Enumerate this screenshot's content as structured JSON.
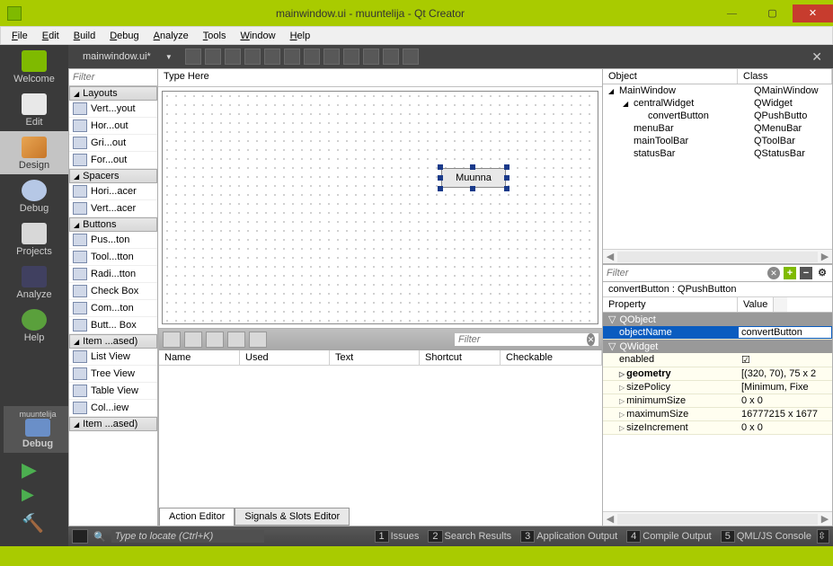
{
  "window": {
    "title": "mainwindow.ui - muuntelija - Qt Creator"
  },
  "menubar": [
    "File",
    "Edit",
    "Build",
    "Debug",
    "Analyze",
    "Tools",
    "Window",
    "Help"
  ],
  "modes": {
    "welcome": "Welcome",
    "edit": "Edit",
    "design": "Design",
    "debug": "Debug",
    "projects": "Projects",
    "analyze": "Analyze",
    "help": "Help"
  },
  "project_label": "muuntelija",
  "run_label": "Debug",
  "open_tab": "mainwindow.ui*",
  "widgetbox": {
    "filter_placeholder": "Filter",
    "categories": [
      {
        "name": "Layouts",
        "items": [
          "Vert...yout",
          "Hor...out",
          "Gri...out",
          "For...out"
        ]
      },
      {
        "name": "Spacers",
        "items": [
          "Hori...acer",
          "Vert...acer"
        ]
      },
      {
        "name": "Buttons",
        "items": [
          "Pus...ton",
          "Tool...tton",
          "Radi...tton",
          "Check Box",
          "Com...ton",
          "Butt... Box"
        ]
      },
      {
        "name": "Item ...ased)",
        "items": [
          "List View",
          "Tree View",
          "Table View",
          "Col...iew"
        ]
      },
      {
        "name": "Item ...ased)",
        "items": []
      }
    ]
  },
  "form": {
    "type_here": "Type Here",
    "button_text": "Muunna"
  },
  "objtree": {
    "col_object": "Object",
    "col_class": "Class",
    "rows": [
      {
        "name": "MainWindow",
        "class": "QMainWindow",
        "indent": 0,
        "expand": true
      },
      {
        "name": "centralWidget",
        "class": "QWidget",
        "indent": 1,
        "expand": true
      },
      {
        "name": "convertButton",
        "class": "QPushButto",
        "indent": 2
      },
      {
        "name": "menuBar",
        "class": "QMenuBar",
        "indent": 1
      },
      {
        "name": "mainToolBar",
        "class": "QToolBar",
        "indent": 1
      },
      {
        "name": "statusBar",
        "class": "QStatusBar",
        "indent": 1
      }
    ]
  },
  "actions": {
    "filter_placeholder": "Filter",
    "cols": [
      "Name",
      "Used",
      "Text",
      "Shortcut",
      "Checkable"
    ],
    "tabs": {
      "action": "Action Editor",
      "signals": "Signals & Slots Editor"
    }
  },
  "props": {
    "filter_placeholder": "Filter",
    "title": "convertButton : QPushButton",
    "col_prop": "Property",
    "col_val": "Value",
    "rows": [
      {
        "cat": "QObject"
      },
      {
        "name": "objectName",
        "value": "convertButton",
        "sel": true
      },
      {
        "cat": "QWidget"
      },
      {
        "name": "enabled",
        "value": "☑"
      },
      {
        "name": "geometry",
        "value": "[(320, 70), 75 x 2",
        "bold": true,
        "tri": true
      },
      {
        "name": "sizePolicy",
        "value": "[Minimum, Fixe",
        "tri": true
      },
      {
        "name": "minimumSize",
        "value": "0 x 0",
        "tri": true
      },
      {
        "name": "maximumSize",
        "value": "16777215 x 1677",
        "tri": true
      },
      {
        "name": "sizeIncrement",
        "value": "0 x 0",
        "tri": true
      }
    ]
  },
  "locator": {
    "placeholder": "Type to locate (Ctrl+K)",
    "items": [
      "Issues",
      "Search Results",
      "Application Output",
      "Compile Output",
      "QML/JS Console"
    ]
  }
}
